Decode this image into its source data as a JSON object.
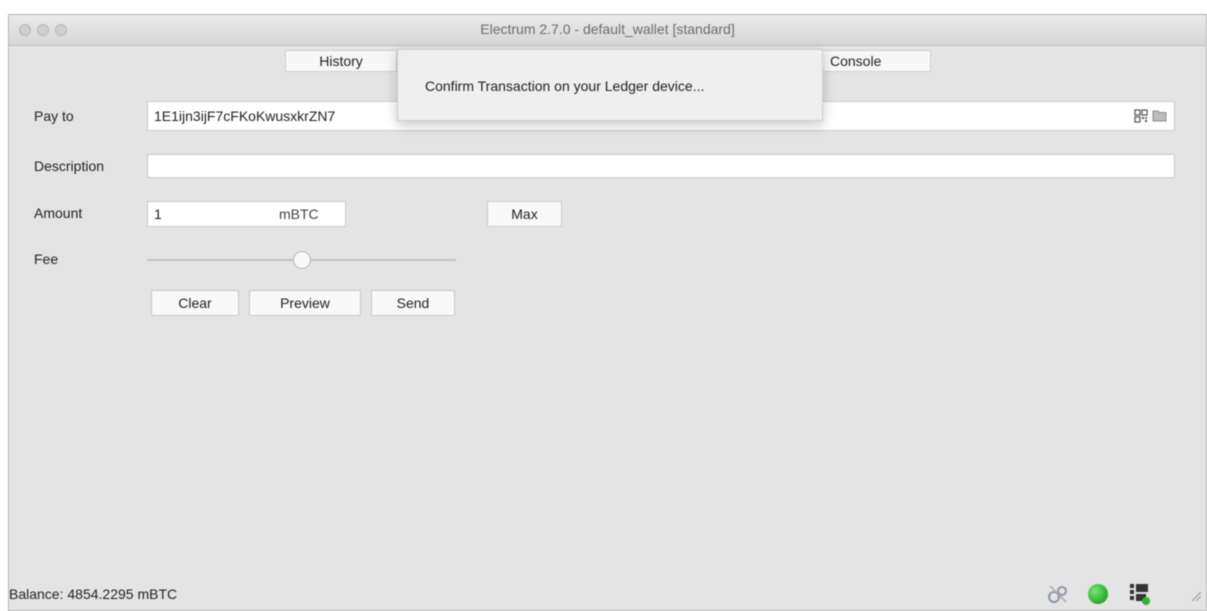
{
  "window": {
    "title": "Electrum 2.7.0  -  default_wallet  [standard]"
  },
  "tabs": [
    {
      "label": "History"
    },
    {
      "label": "Console"
    }
  ],
  "popup": {
    "message": "Confirm Transaction on your Ledger device..."
  },
  "form": {
    "pay_to_label": "Pay to",
    "pay_to_value": "1E1ijn3ijF7cFKoKwusxkrZN7",
    "description_label": "Description",
    "description_value": "",
    "amount_label": "Amount",
    "amount_value": "1",
    "amount_unit": "mBTC",
    "max_label": "Max",
    "fee_label": "Fee",
    "fee_level": 0.5
  },
  "buttons": {
    "clear": "Clear",
    "preview": "Preview",
    "send": "Send"
  },
  "status": {
    "balance": "Balance: 4854.2295 mBTC"
  },
  "colors": {
    "window_bg": "#e4e4e4",
    "connected_green": "#2fb52f"
  },
  "icons": [
    "qr-code-icon",
    "folder-icon",
    "preferences-icon",
    "network-status-icon",
    "seed-icon",
    "resize-grip-icon"
  ]
}
